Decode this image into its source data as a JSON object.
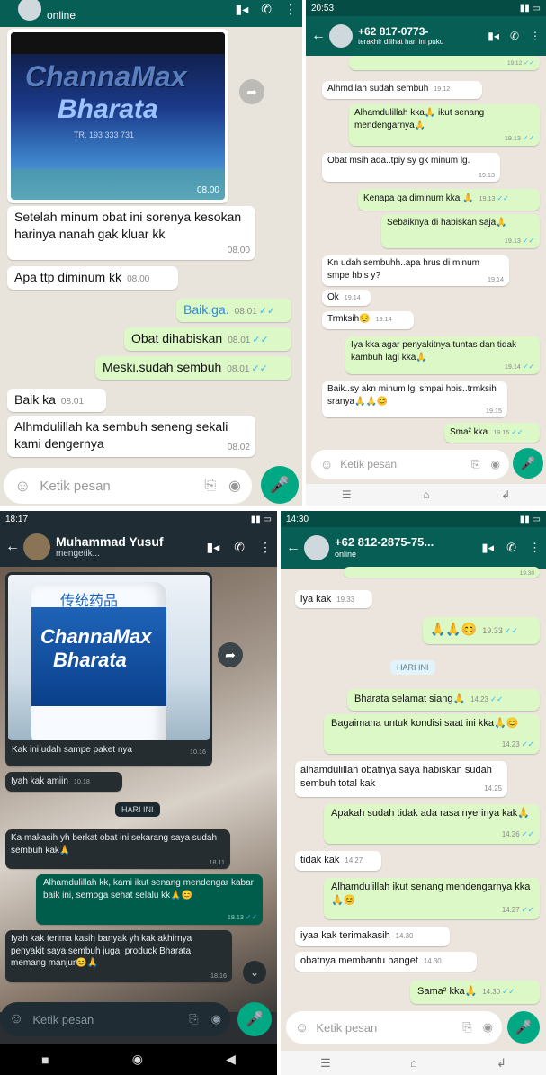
{
  "tl": {
    "status": "online",
    "image_brand": "ChannaMax",
    "image_product": "Bharata",
    "image_reg": "TR. 193 333 731",
    "image_time": "08.00",
    "msg1": "Setelah minum obat ini sorenya kesokan harinya nanah gak kluar kk",
    "msg1_time": "08.00",
    "msg2": "Apa ttp diminum kk",
    "msg2_time": "08.00",
    "msg3": "Baik.ga.",
    "msg3_time": "08.01",
    "msg4": "Obat dihabiskan",
    "msg4_time": "08.01",
    "msg5": "Meski.sudah sembuh",
    "msg5_time": "08.01",
    "msg6": "Baik ka",
    "msg6_time": "08.01",
    "msg7": "Alhmdulillah ka sembuh seneng sekali kami dengernya",
    "msg7_time": "08.02",
    "input_placeholder": "Ketik pesan"
  },
  "tr": {
    "clock": "20:53",
    "contact": "+62 817-0773-",
    "last_seen": "terakhir dilihat hari ini puku",
    "top_time": "19.12",
    "m1": "Alhmdllah sudah sembuh",
    "m1_time": "19.12",
    "m2": "Alhamdulillah kka🙏 ikut senang mendengarnya🙏",
    "m2_time": "19.13",
    "m3": "Obat msih ada..tpiy sy gk minum lg.",
    "m3_time": "19.13",
    "m4": "Kenapa ga diminum kka 🙏",
    "m4_time": "19.13",
    "m5": "Sebaiknya di habiskan saja🙏",
    "m5_time": "19.13",
    "m6": "Kn udah sembuhh..apa hrus di minum smpe hbis y?",
    "m6_time": "19.14",
    "m7": "Ok",
    "m7_time": "19.14",
    "m8": "Trmksih😔",
    "m8_time": "19.14",
    "m9": "Iya kka agar penyakitnya tuntas dan tidak kambuh lagi kka🙏",
    "m9_time": "19.14",
    "m10": "Baik..sy akn minum lgi smpai hbis..trmksih sranya🙏🙏😊",
    "m10_time": "19.15",
    "m11": "Sma² kka",
    "m11_time": "19.15",
    "input_placeholder": "Ketik pesan"
  },
  "bl": {
    "clock": "18:17",
    "contact": "Muhammad Yusuf",
    "typing": "mengetik...",
    "image_brand": "ChannaMax",
    "image_product": "Bharata",
    "image_chinese": "传统药品",
    "image_caption": "Kak ini udah sampe paket nya",
    "image_time": "10.16",
    "m1": "Iyah kak amiin",
    "m1_time": "10.18",
    "date": "HARI INI",
    "m2": "Ka makasih yh berkat obat ini sekarang saya sudah sembuh kak🙏",
    "m2_time": "18.11",
    "m3": "Alhamdulillah kk, kami ikut senang mendengar kabar baik ini, semoga sehat selalu kk🙏😊",
    "m3_time": "18.13",
    "m4": "Iyah kak terima kasih banyak yh kak akhirnya penyakit saya sembuh juga, produck Bharata memang manjur😊🙏",
    "m4_time": "18.16",
    "input_placeholder": "Ketik pesan"
  },
  "br": {
    "clock": "14:30",
    "contact": "+62 812-2875-75...",
    "status": "online",
    "top_time": "19.30",
    "m1": "iya kak",
    "m1_time": "19.33",
    "m2": "🙏🙏😊",
    "m2_time": "19.33",
    "date": "HARI INI",
    "m3": "Bharata selamat siang🙏",
    "m3_time": "14.23",
    "m4": "Bagaimana untuk kondisi saat ini kka🙏😊",
    "m4_time": "14.23",
    "m5": "alhamdulillah obatnya saya habiskan sudah sembuh total kak",
    "m5_time": "14.25",
    "m6": "Apakah sudah tidak ada rasa nyerinya kak🙏",
    "m6_time": "14.26",
    "m7": "tidak kak",
    "m7_time": "14.27",
    "m8": "Alhamdulillah ikut senang mendengarnya kka🙏😊",
    "m8_time": "14.27",
    "m9": "iyaa kak terimakasih",
    "m9_time": "14.30",
    "m10": "obatnya membantu banget",
    "m10_time": "14.30",
    "m11": "Sama² kka🙏",
    "m11_time": "14.30",
    "input_placeholder": "Ketik pesan"
  }
}
